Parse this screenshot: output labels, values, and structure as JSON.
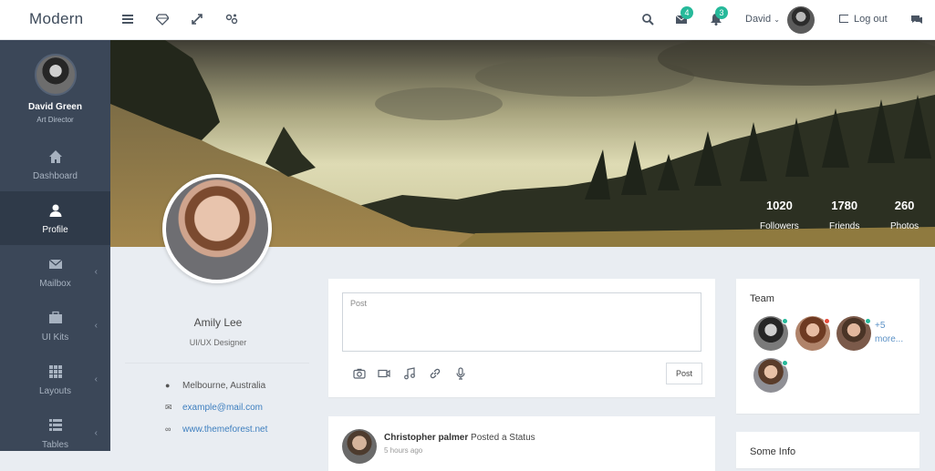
{
  "app": {
    "logo": "Modern"
  },
  "topbar": {
    "icons": [
      "menu-icon",
      "diamond-icon",
      "expand-icon",
      "share-icon"
    ],
    "mail_count": "4",
    "notify_count": "3",
    "user_name": "David",
    "logout_label": "Log out"
  },
  "sidebar": {
    "user_name": "David Green",
    "user_role": "Art Director",
    "items": [
      {
        "label": "Dashboard",
        "icon": "home-icon"
      },
      {
        "label": "Profile",
        "icon": "user-icon"
      },
      {
        "label": "Mailbox",
        "icon": "envelope-icon"
      },
      {
        "label": "UI Kits",
        "icon": "briefcase-icon"
      },
      {
        "label": "Layouts",
        "icon": "grid-icon"
      },
      {
        "label": "Tables",
        "icon": "list-icon"
      }
    ]
  },
  "stats": [
    {
      "value": "1020",
      "label": "Followers"
    },
    {
      "value": "1780",
      "label": "Friends"
    },
    {
      "value": "260",
      "label": "Photos"
    }
  ],
  "profile": {
    "name": "Amily Lee",
    "role": "UI/UX Designer",
    "location": "Melbourne, Australia",
    "email": "example@mail.com",
    "website": "www.themeforest.net"
  },
  "post": {
    "placeholder": "Post",
    "button": "Post"
  },
  "feed": {
    "author": "Christopher palmer",
    "action": "Posted a Status",
    "time": "5 hours ago"
  },
  "team": {
    "title": "Team",
    "more": "+5",
    "more2": "more...",
    "status_colors": [
      "#26b99a",
      "#e74c3c",
      "#26b99a",
      "#26b99a"
    ]
  },
  "info": {
    "title": "Some Info"
  },
  "colors": {
    "accent": "#26b99a",
    "sidebar": "#3b4758",
    "link": "#3e7fbf"
  }
}
